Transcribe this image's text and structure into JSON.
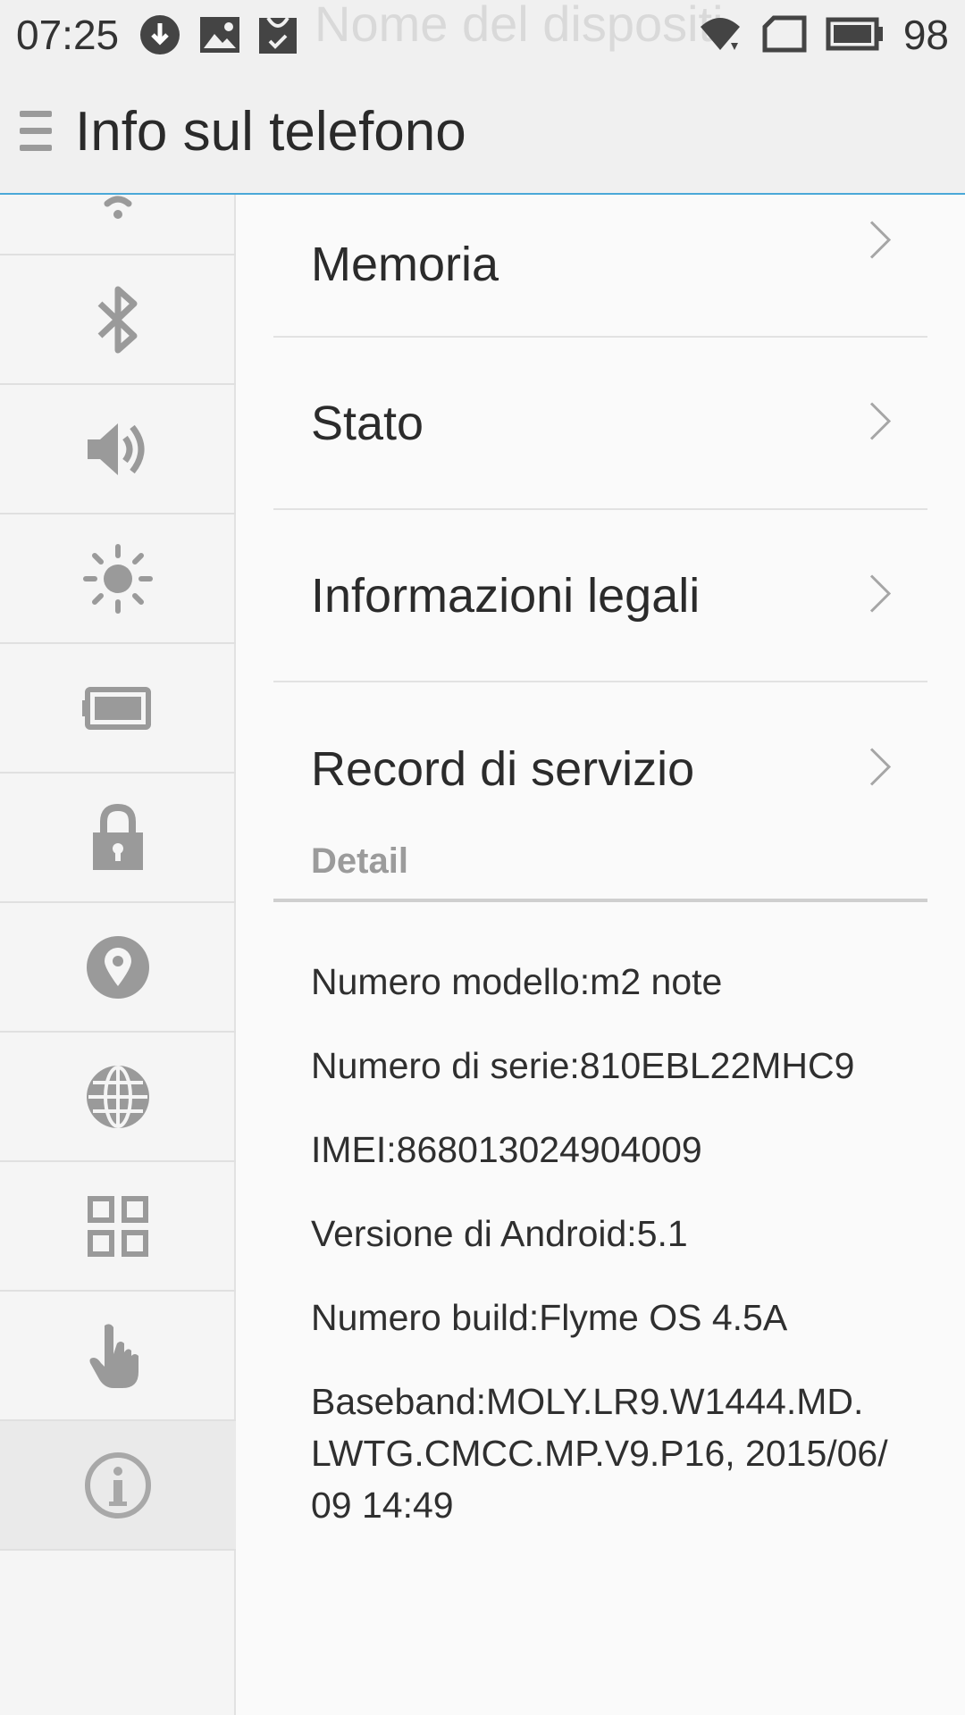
{
  "status_bar": {
    "time": "07:25",
    "battery_percent": "98",
    "left_icons": [
      "download-icon",
      "image-icon",
      "shopping-bag-icon"
    ],
    "right_icons": [
      "wifi-icon",
      "sim-icon",
      "battery-icon"
    ]
  },
  "header": {
    "title": "Info sul telefono",
    "ghost_text": "Nome del dispositi"
  },
  "rail": {
    "items": [
      {
        "icon": "wifi-icon"
      },
      {
        "icon": "bluetooth-icon"
      },
      {
        "icon": "speaker-icon"
      },
      {
        "icon": "brightness-icon"
      },
      {
        "icon": "battery-icon"
      },
      {
        "icon": "lock-icon"
      },
      {
        "icon": "location-icon"
      },
      {
        "icon": "globe-icon"
      },
      {
        "icon": "apps-grid-icon"
      },
      {
        "icon": "hand-icon"
      },
      {
        "icon": "info-icon",
        "active": true
      }
    ]
  },
  "menu": {
    "items": [
      {
        "label": "Memoria"
      },
      {
        "label": "Stato"
      },
      {
        "label": "Informazioni legali"
      },
      {
        "label": "Record di servizio"
      }
    ]
  },
  "detail": {
    "title": "Detail",
    "lines": [
      "Numero modello:m2 note",
      "Numero di serie:810EBL22MHC9",
      "IMEI:868013024904009",
      "Versione di Android:5.1",
      "Numero build:Flyme OS 4.5A",
      "Baseband:MOLY.LR9.W1444.MD.\nLWTG.CMCC.MP.V9.P16, 2015/06/\n09 14:49"
    ]
  },
  "colors": {
    "accent": "#4aa8d8",
    "icon_gray": "#9a9a9a",
    "background": "#fafafa"
  }
}
